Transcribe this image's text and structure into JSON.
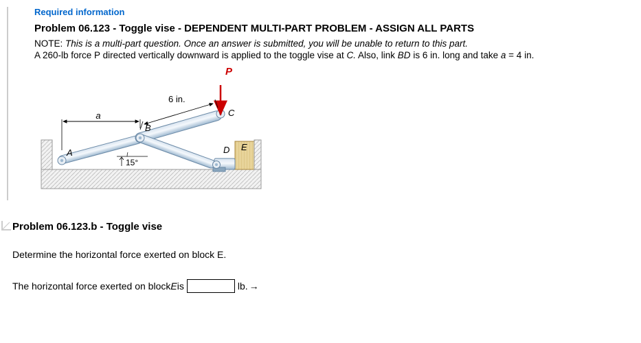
{
  "header": {
    "required": "Required information",
    "title": "Problem 06.123 - Toggle vise - DEPENDENT MULTI-PART PROBLEM - ASSIGN ALL PARTS",
    "note_prefix": "NOTE: ",
    "note_italic": "This is a multi-part question. Once an answer is submitted, you will be unable to return to this part.",
    "given1": "A 260-lb force P directed vertically downward is applied to the toggle vise at ",
    "given_c": "C.",
    "given2": " Also, link ",
    "given_bd": "BD",
    "given3": " is 6 in. long and take ",
    "given_a": "a",
    "given4": " = 4 in."
  },
  "diagram": {
    "P_label": "P",
    "six_in": "6 in.",
    "a_label": "a",
    "A": "A",
    "B": "B",
    "C": "C",
    "D": "D",
    "E": "E",
    "angle": "15°"
  },
  "sub": {
    "title": "Problem 06.123.b - Toggle vise",
    "question_prefix": "Determine the horizontal force exerted on block ",
    "question_e": "E.",
    "answer_prefix": "The horizontal force exerted on block ",
    "answer_e": "E",
    "answer_mid": " is ",
    "unit": "lb.",
    "arrow": "→"
  }
}
